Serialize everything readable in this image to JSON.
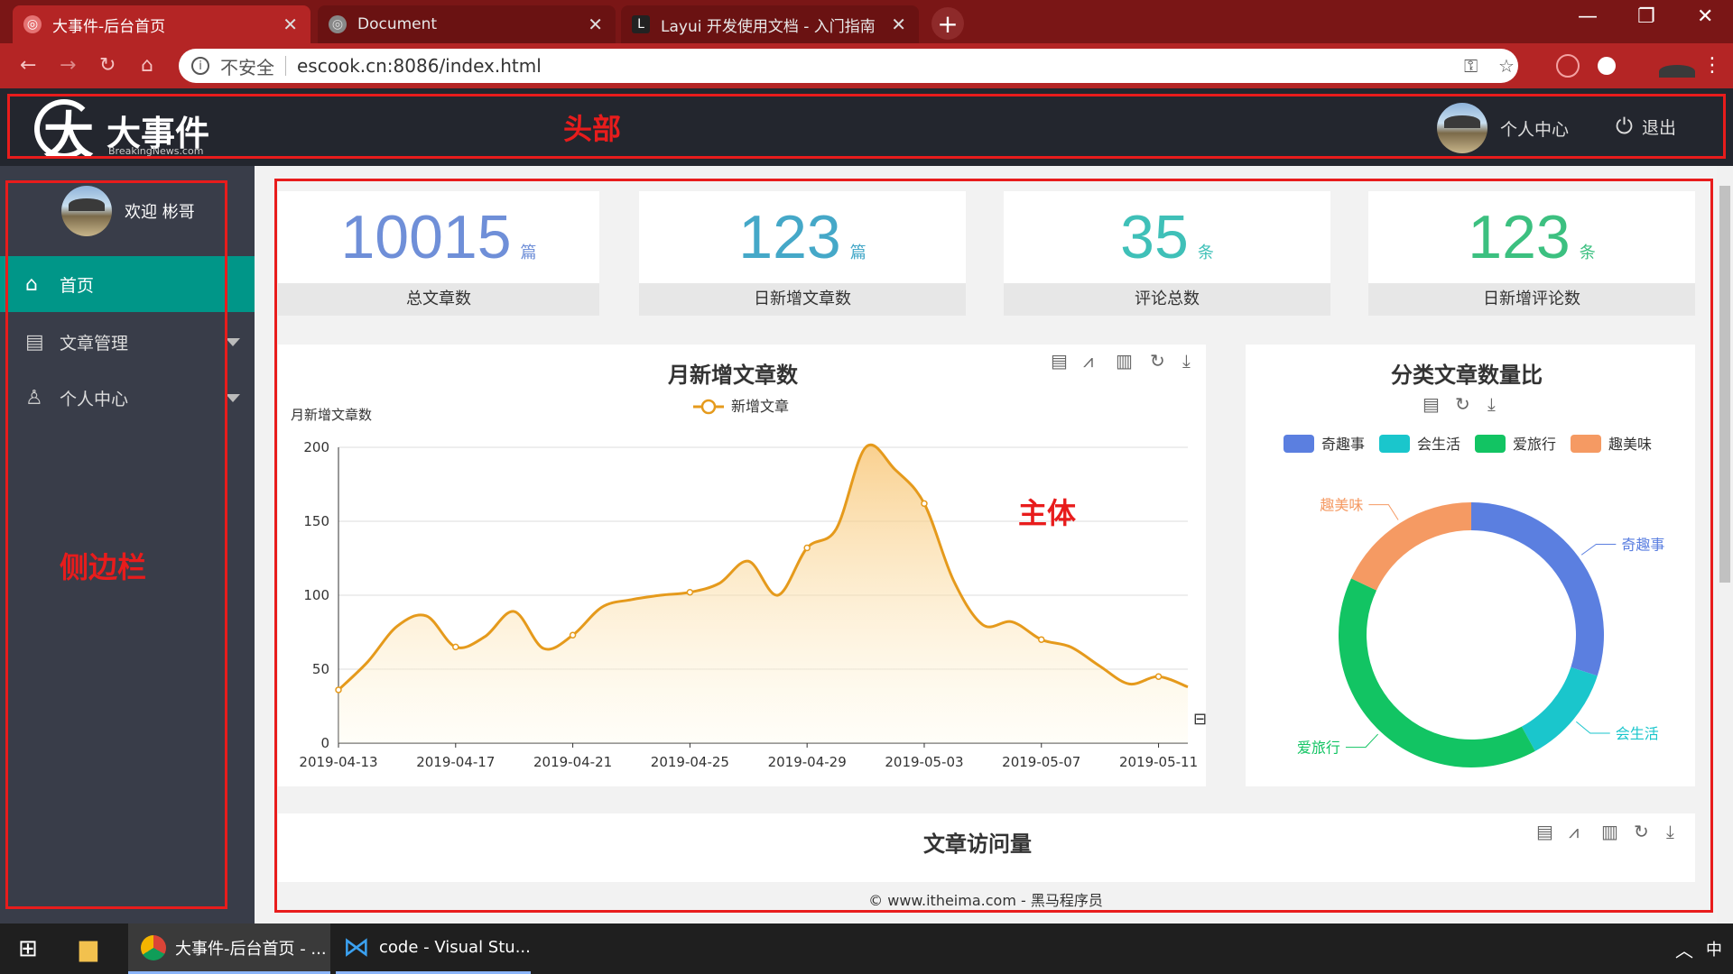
{
  "browser": {
    "tabs": [
      {
        "title": "大事件-后台首页"
      },
      {
        "title": "Document"
      },
      {
        "title": "Layui 开发使用文档 - 入门指南"
      }
    ],
    "security_label": "不安全",
    "url": "escook.cn:8086/index.html"
  },
  "header": {
    "logo_text": "大事件",
    "logo_sub": "BreakingNews.com",
    "annotation": "头部",
    "personal_center": "个人中心",
    "logout": "退出"
  },
  "sidebar": {
    "welcome": "欢迎  彬哥",
    "annotation": "侧边栏",
    "items": [
      {
        "label": "首页",
        "icon": "home-icon",
        "active": true
      },
      {
        "label": "文章管理",
        "icon": "document-icon",
        "active": false
      },
      {
        "label": "个人中心",
        "icon": "user-icon",
        "active": false
      }
    ]
  },
  "main": {
    "annotation": "主体",
    "stats": [
      {
        "value": "10015",
        "unit": "篇",
        "label": "总文章数",
        "color": "#6f8fd8"
      },
      {
        "value": "123",
        "unit": "篇",
        "label": "日新增文章数",
        "color": "#45a8c8"
      },
      {
        "value": "35",
        "unit": "条",
        "label": "评论总数",
        "color": "#3fc0b8"
      },
      {
        "value": "123",
        "unit": "条",
        "label": "日新增评论数",
        "color": "#3cc080"
      }
    ],
    "line_chart_title": "月新增文章数",
    "pie_chart_title": "分类文章数量比",
    "visits_title": "文章访问量"
  },
  "chart_data": [
    {
      "type": "area",
      "title": "月新增文章数",
      "ylabel": "月新增文章数",
      "legend": [
        "新增文章"
      ],
      "ylim": [
        0,
        200
      ],
      "yticks": [
        0,
        50,
        100,
        150,
        200
      ],
      "xtick_labels": [
        "2019-04-13",
        "2019-04-17",
        "2019-04-21",
        "2019-04-25",
        "2019-04-29",
        "2019-05-03",
        "2019-05-07",
        "2019-05-11"
      ],
      "x": [
        "2019-04-13",
        "2019-04-14",
        "2019-04-15",
        "2019-04-16",
        "2019-04-17",
        "2019-04-18",
        "2019-04-19",
        "2019-04-20",
        "2019-04-21",
        "2019-04-22",
        "2019-04-23",
        "2019-04-24",
        "2019-04-25",
        "2019-04-26",
        "2019-04-27",
        "2019-04-28",
        "2019-04-29",
        "2019-04-30",
        "2019-05-01",
        "2019-05-02",
        "2019-05-03",
        "2019-05-04",
        "2019-05-05",
        "2019-05-06",
        "2019-05-07",
        "2019-05-08",
        "2019-05-09",
        "2019-05-10",
        "2019-05-11",
        "2019-05-12"
      ],
      "series": [
        {
          "name": "新增文章",
          "values": [
            36,
            55,
            79,
            86,
            65,
            72,
            89,
            64,
            73,
            92,
            97,
            100,
            102,
            108,
            123,
            100,
            132,
            145,
            200,
            185,
            162,
            110,
            80,
            82,
            70,
            65,
            52,
            40,
            45,
            38
          ]
        }
      ],
      "color": "#e59a1c"
    },
    {
      "type": "pie",
      "title": "分类文章数量比",
      "donut": true,
      "categories": [
        "奇趣事",
        "会生活",
        "爱旅行",
        "趣美味"
      ],
      "values": [
        30,
        12,
        40,
        18
      ],
      "colors": [
        "#5b7fe0",
        "#1ac6cc",
        "#12c463",
        "#f59a63"
      ]
    }
  ]
}
